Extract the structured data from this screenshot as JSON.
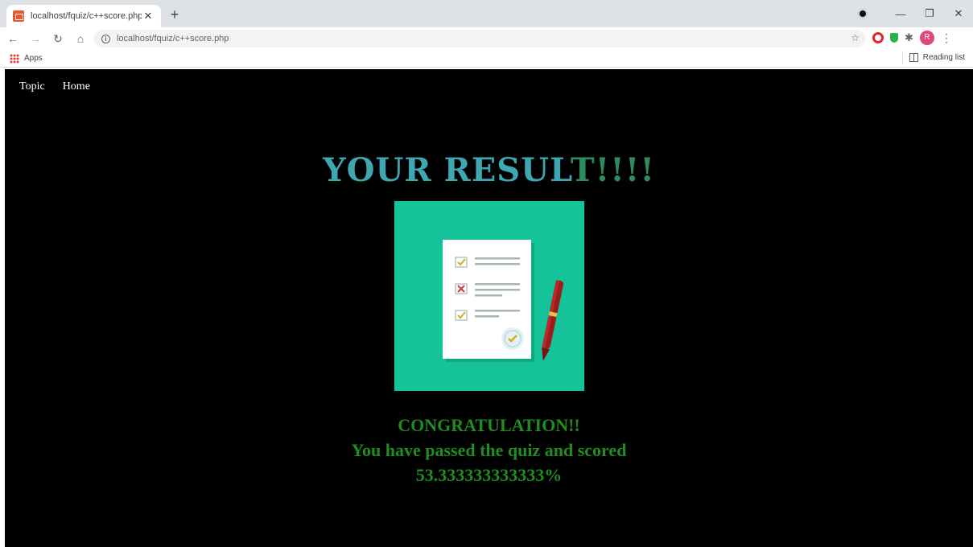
{
  "browser": {
    "tab": {
      "title": "localhost/fquiz/c++score.php"
    },
    "address_bar": {
      "url": "localhost/fquiz/c++score.php"
    },
    "bookmarks": {
      "apps_label": "Apps",
      "reading_list_label": "Reading list"
    },
    "profile_initial": "R",
    "icons": [
      "back-icon",
      "forward-icon",
      "reload-icon",
      "home-icon",
      "info-icon",
      "star-icon",
      "opera-icon",
      "shield-icon",
      "puzzle-icon",
      "menu-icon"
    ]
  },
  "page": {
    "nav": [
      {
        "label": "Topic"
      },
      {
        "label": "Home"
      }
    ],
    "title_part1": "YOUR RESUL",
    "title_part2": "T!!!!",
    "illustration_bg": "#15c39a",
    "congrats": "CONGRATULATION!!",
    "message": "You have passed the quiz and scored",
    "score": "53.333333333333%",
    "colors": {
      "background": "#000000",
      "title_teal": "#3ea7b1",
      "title_green": "#2e8a5f",
      "message_green": "#1f8d1f"
    }
  }
}
